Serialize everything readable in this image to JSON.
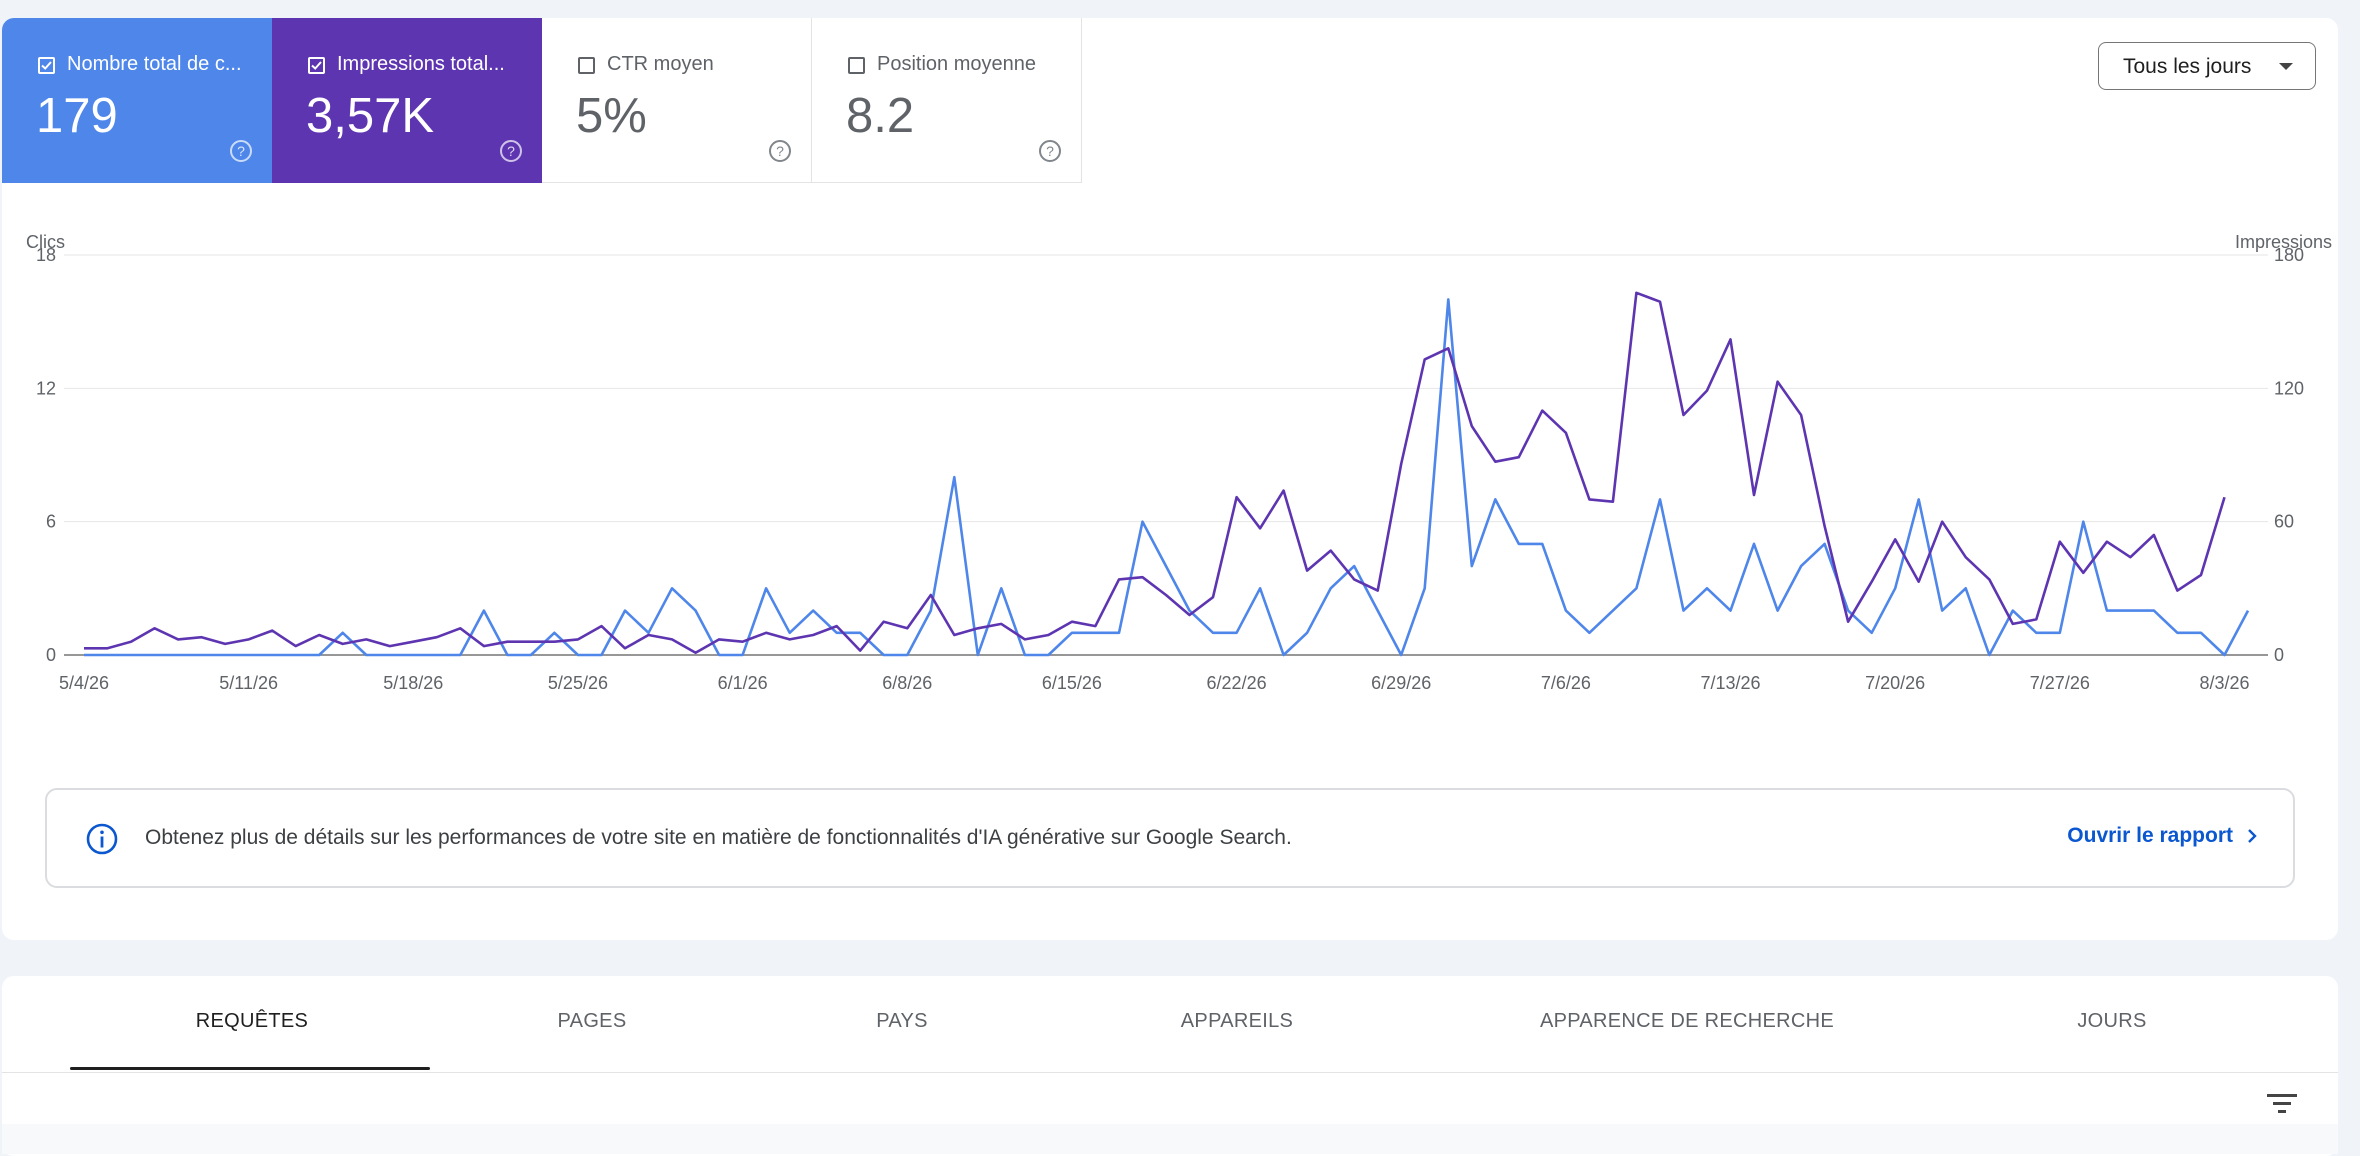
{
  "metrics": [
    {
      "label": "Nombre total de c...",
      "value": "179",
      "checked": true
    },
    {
      "label": "Impressions total...",
      "value": "3,57K",
      "checked": true
    },
    {
      "label": "CTR moyen",
      "value": "5%",
      "checked": false
    },
    {
      "label": "Position moyenne",
      "value": "8.2",
      "checked": false
    }
  ],
  "date_range": {
    "label": "Tous les jours"
  },
  "colors": {
    "clicks": "#4e86ea",
    "impressions": "#5e35b1",
    "link": "#0b57d0"
  },
  "chart_data": {
    "type": "line",
    "y_left_label": "Clics",
    "y_right_label": "Impressions",
    "y_left_ticks": [
      "0",
      "6",
      "12",
      "18"
    ],
    "y_right_ticks": [
      "0",
      "60",
      "120",
      "180"
    ],
    "ylim_left": [
      0,
      18
    ],
    "ylim_right": [
      0,
      180
    ],
    "x_tick_labels": [
      "5/4/26",
      "5/11/26",
      "5/18/26",
      "5/25/26",
      "6/1/26",
      "6/8/26",
      "6/15/26",
      "6/22/26",
      "6/29/26",
      "7/6/26",
      "7/13/26",
      "7/20/26",
      "7/27/26",
      "8/3/26"
    ],
    "x_start": "5/4/26",
    "grid": true,
    "series": [
      {
        "name": "Clics",
        "axis": "left",
        "values": [
          0,
          0,
          0,
          0,
          0,
          0,
          0,
          0,
          0,
          0,
          0,
          1,
          0,
          0,
          0,
          0,
          0,
          2,
          0,
          0,
          1,
          0,
          0,
          2,
          1,
          3,
          2,
          0,
          0,
          3,
          1,
          2,
          1,
          1,
          0,
          0,
          2,
          8,
          0,
          3,
          0,
          0,
          1,
          1,
          1,
          6,
          4,
          2,
          1,
          1,
          3,
          0,
          1,
          3,
          4,
          2,
          0,
          3,
          16,
          4,
          7,
          5,
          5,
          2,
          1,
          2,
          3,
          7,
          2,
          3,
          2,
          5,
          2,
          4,
          5,
          2,
          1,
          3,
          7,
          2,
          3,
          0,
          2,
          1,
          1,
          6,
          2,
          2,
          2,
          1,
          1,
          0,
          2
        ]
      },
      {
        "name": "Impressions",
        "axis": "right",
        "values": [
          3,
          3,
          6,
          12,
          7,
          8,
          5,
          7,
          11,
          4,
          9,
          5,
          7,
          4,
          6,
          8,
          12,
          4,
          6,
          6,
          6,
          7,
          13,
          3,
          9,
          7,
          1,
          7,
          6,
          10,
          7,
          9,
          13,
          2,
          15,
          12,
          27,
          9,
          12,
          14,
          7,
          9,
          15,
          13,
          34,
          35,
          27,
          18,
          26,
          71,
          57,
          74,
          38,
          47,
          34,
          29,
          86,
          133,
          138,
          103,
          87,
          89,
          110,
          100,
          70,
          69,
          163,
          159,
          108,
          119,
          142,
          72,
          123,
          108,
          58,
          15,
          33,
          52,
          33,
          60,
          44,
          34,
          14,
          16,
          51,
          37,
          51,
          44,
          54,
          29,
          36,
          71
        ]
      }
    ]
  },
  "banner": {
    "text": "Obtenez plus de détails sur les performances de votre site en matière de fonctionnalités d'IA générative sur Google Search.",
    "link": "Ouvrir le rapport"
  },
  "tabs": [
    "REQUÊTES",
    "PAGES",
    "PAYS",
    "APPAREILS",
    "APPARENCE DE RECHERCHE",
    "JOURS"
  ]
}
